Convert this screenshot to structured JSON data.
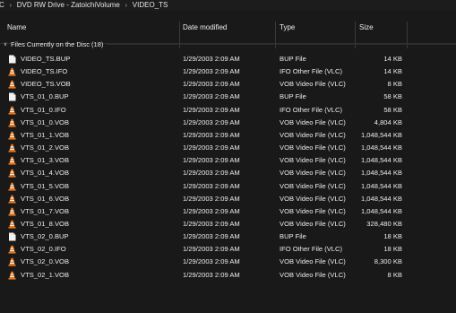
{
  "breadcrumb": {
    "items": [
      "C",
      "DVD RW Drive - ZatoichiVolume",
      "VIDEO_TS"
    ],
    "separator": "›"
  },
  "columns": {
    "name": "Name",
    "date": "Date modified",
    "type": "Type",
    "size": "Size"
  },
  "group": {
    "label": "Files Currently on the Disc (18)",
    "chevron": "∨"
  },
  "icons": {
    "file": "file-icon",
    "vlc": "vlc-cone-icon"
  },
  "colors": {
    "background": "#191919",
    "vlc_orange": "#e8761b",
    "file_white": "#f2f2f2"
  },
  "files": [
    {
      "name": "VIDEO_TS.BUP",
      "date": "1/29/2003 2:09 AM",
      "type": "BUP File",
      "size": "14 KB",
      "icon": "file"
    },
    {
      "name": "VIDEO_TS.IFO",
      "date": "1/29/2003 2:09 AM",
      "type": "IFO Other File (VLC)",
      "size": "14 KB",
      "icon": "vlc"
    },
    {
      "name": "VIDEO_TS.VOB",
      "date": "1/29/2003 2:09 AM",
      "type": "VOB Video File (VLC)",
      "size": "8 KB",
      "icon": "vlc"
    },
    {
      "name": "VTS_01_0.BUP",
      "date": "1/29/2003 2:09 AM",
      "type": "BUP File",
      "size": "58 KB",
      "icon": "file"
    },
    {
      "name": "VTS_01_0.IFO",
      "date": "1/29/2003 2:09 AM",
      "type": "IFO Other File (VLC)",
      "size": "58 KB",
      "icon": "vlc"
    },
    {
      "name": "VTS_01_0.VOB",
      "date": "1/29/2003 2:09 AM",
      "type": "VOB Video File (VLC)",
      "size": "4,804 KB",
      "icon": "vlc"
    },
    {
      "name": "VTS_01_1.VOB",
      "date": "1/29/2003 2:09 AM",
      "type": "VOB Video File (VLC)",
      "size": "1,048,544 KB",
      "icon": "vlc"
    },
    {
      "name": "VTS_01_2.VOB",
      "date": "1/29/2003 2:09 AM",
      "type": "VOB Video File (VLC)",
      "size": "1,048,544 KB",
      "icon": "vlc"
    },
    {
      "name": "VTS_01_3.VOB",
      "date": "1/29/2003 2:09 AM",
      "type": "VOB Video File (VLC)",
      "size": "1,048,544 KB",
      "icon": "vlc"
    },
    {
      "name": "VTS_01_4.VOB",
      "date": "1/29/2003 2:09 AM",
      "type": "VOB Video File (VLC)",
      "size": "1,048,544 KB",
      "icon": "vlc"
    },
    {
      "name": "VTS_01_5.VOB",
      "date": "1/29/2003 2:09 AM",
      "type": "VOB Video File (VLC)",
      "size": "1,048,544 KB",
      "icon": "vlc"
    },
    {
      "name": "VTS_01_6.VOB",
      "date": "1/29/2003 2:09 AM",
      "type": "VOB Video File (VLC)",
      "size": "1,048,544 KB",
      "icon": "vlc"
    },
    {
      "name": "VTS_01_7.VOB",
      "date": "1/29/2003 2:09 AM",
      "type": "VOB Video File (VLC)",
      "size": "1,048,544 KB",
      "icon": "vlc"
    },
    {
      "name": "VTS_01_8.VOB",
      "date": "1/29/2003 2:09 AM",
      "type": "VOB Video File (VLC)",
      "size": "328,480 KB",
      "icon": "vlc"
    },
    {
      "name": "VTS_02_0.BUP",
      "date": "1/29/2003 2:09 AM",
      "type": "BUP File",
      "size": "18 KB",
      "icon": "file"
    },
    {
      "name": "VTS_02_0.IFO",
      "date": "1/29/2003 2:09 AM",
      "type": "IFO Other File (VLC)",
      "size": "18 KB",
      "icon": "vlc"
    },
    {
      "name": "VTS_02_0.VOB",
      "date": "1/29/2003 2:09 AM",
      "type": "VOB Video File (VLC)",
      "size": "8,300 KB",
      "icon": "vlc"
    },
    {
      "name": "VTS_02_1.VOB",
      "date": "1/29/2003 2:09 AM",
      "type": "VOB Video File (VLC)",
      "size": "8 KB",
      "icon": "vlc"
    }
  ]
}
